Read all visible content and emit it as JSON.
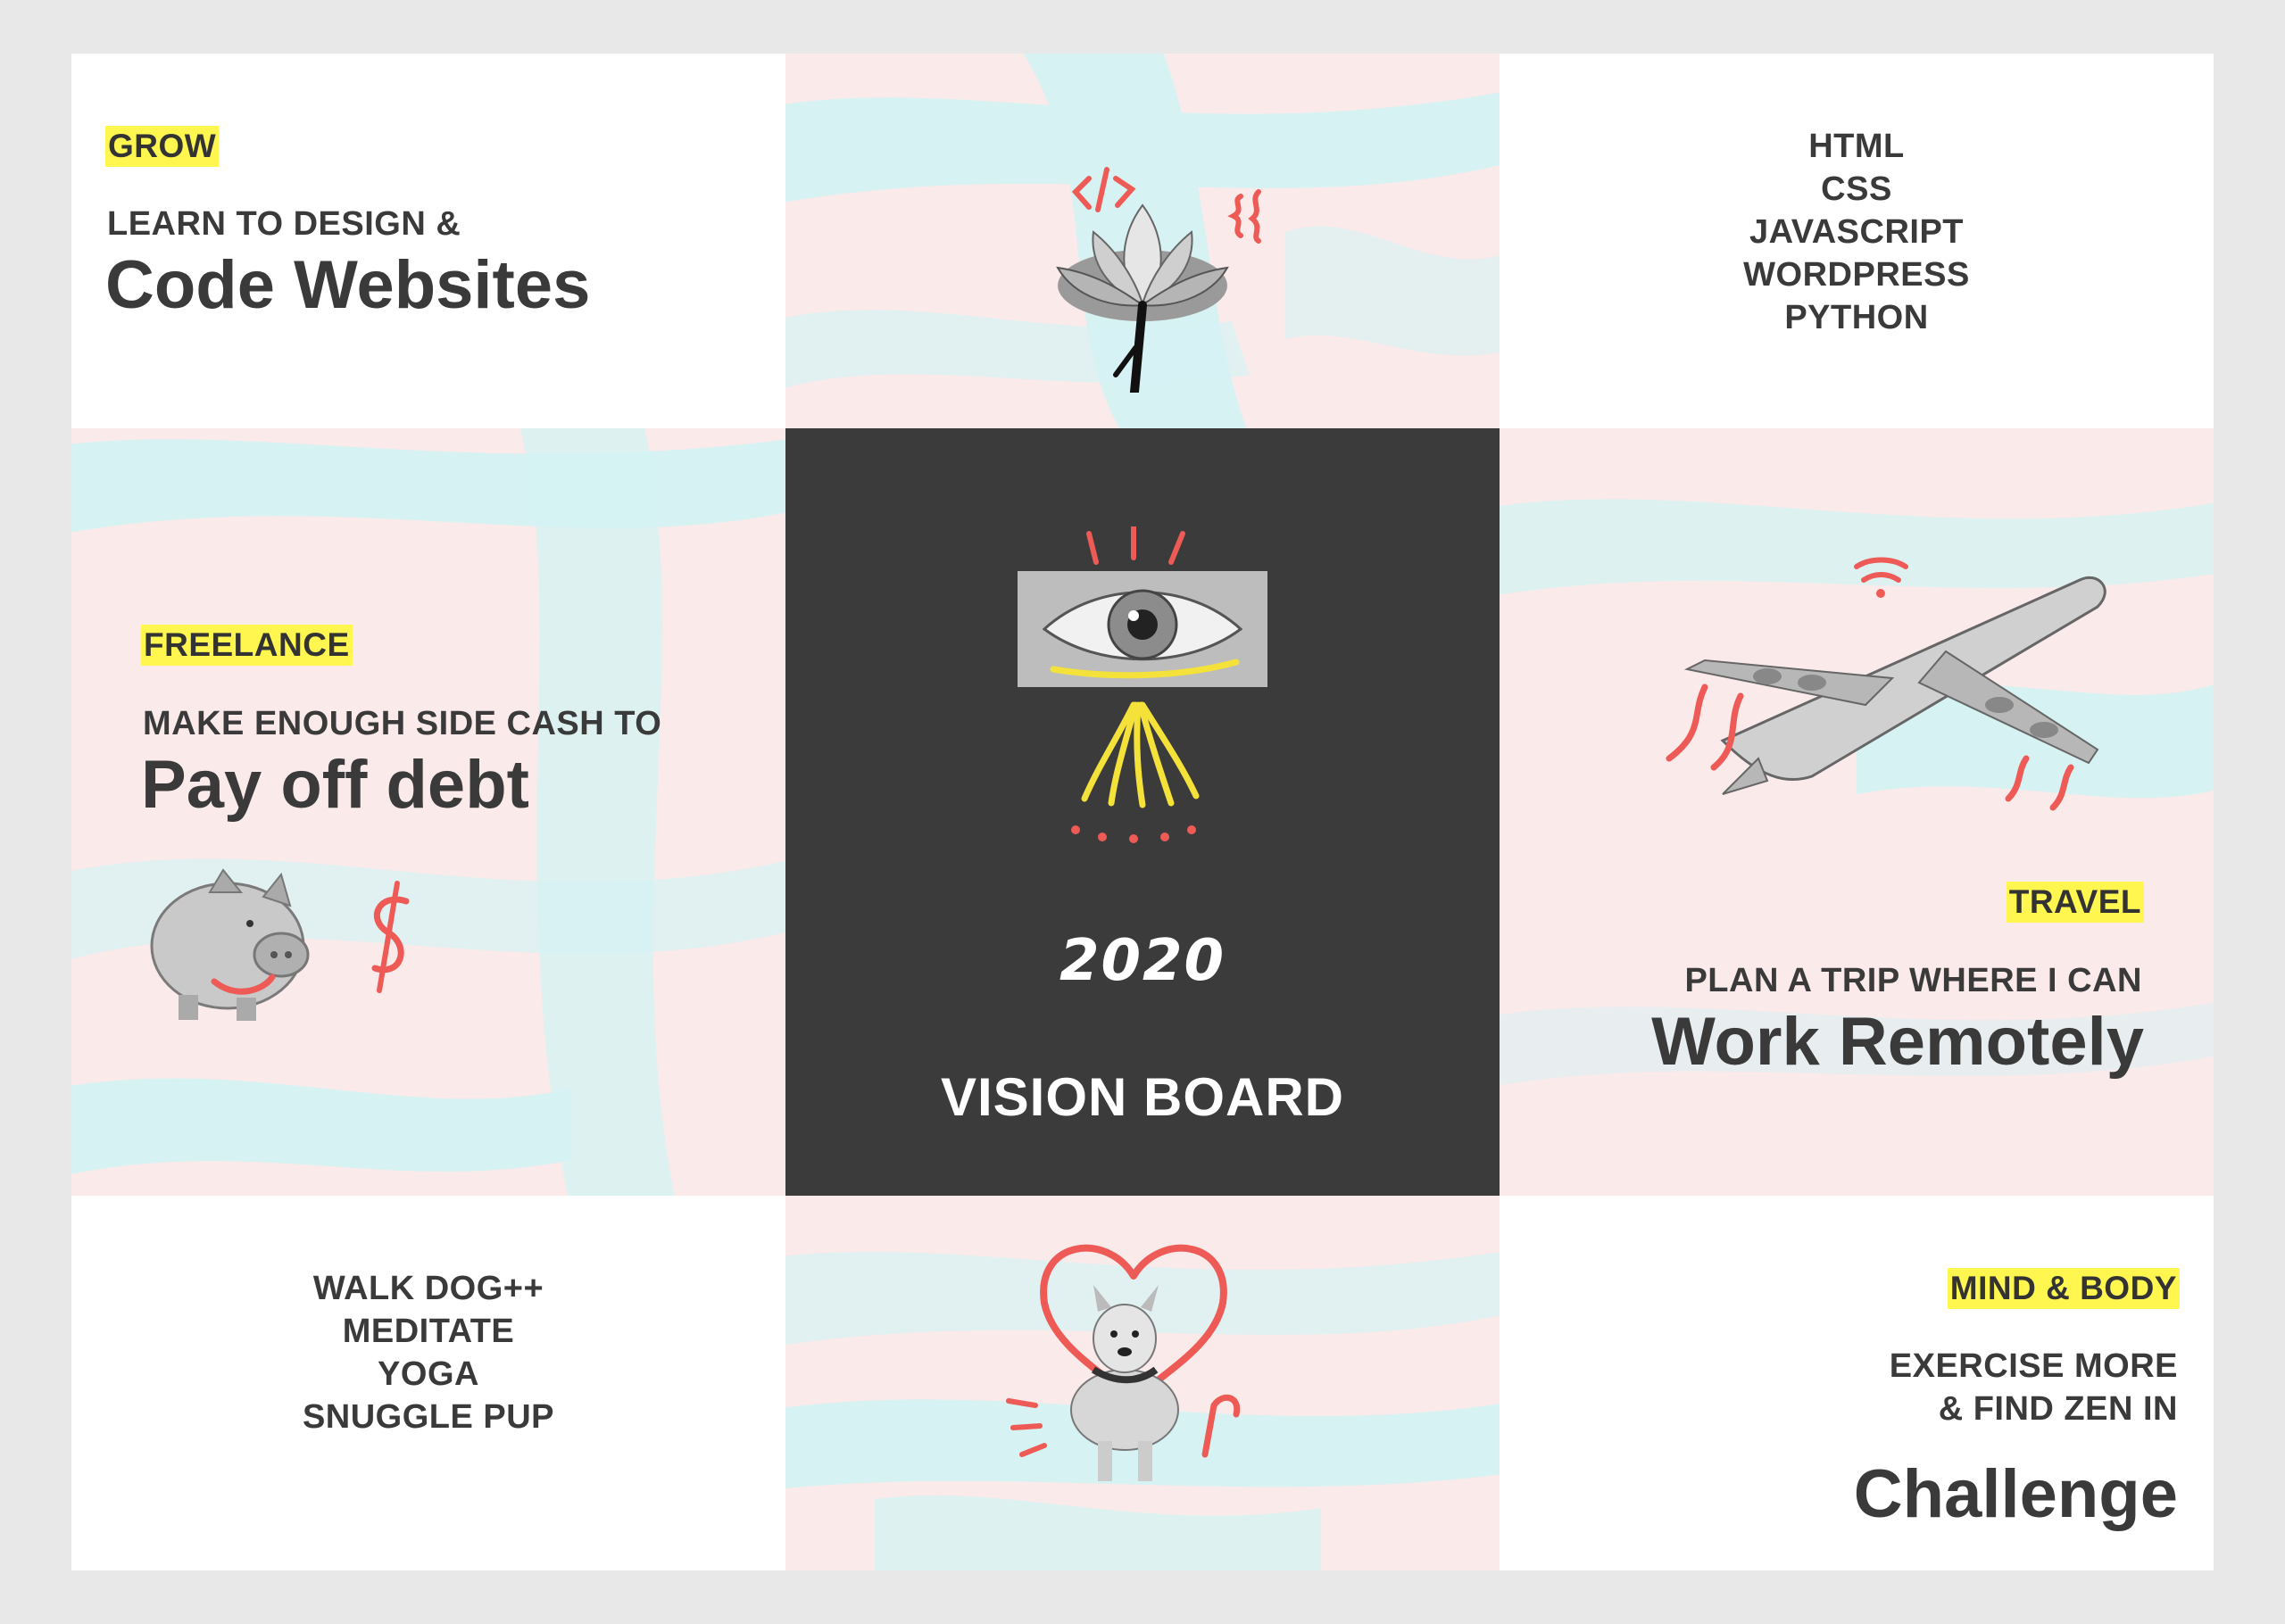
{
  "colors": {
    "background": "#e8e8e8",
    "highlight": "#fff64f",
    "text": "#3a3a3a",
    "pastel_pink": "#fbeaea",
    "pastel_blue": "#d6f2f3",
    "center_dark": "#3b3b3b",
    "doodle_red": "#ee5a55",
    "doodle_yellow": "#f4e23a"
  },
  "grow": {
    "tag": "GROW",
    "line1": "LEARN TO DESIGN &",
    "line2": "Code Websites",
    "icon": "lotus-code-icon"
  },
  "skills": [
    "HTML",
    "CSS",
    "JAVASCRIPT",
    "WORDPRESS",
    "PYTHON"
  ],
  "freelance": {
    "tag": "FREELANCE",
    "line1": "MAKE ENOUGH SIDE CASH TO",
    "line2": "Pay off debt",
    "icon": "piggy-bank-icon"
  },
  "center": {
    "year": "2020",
    "title": "VISION BOARD",
    "icon": "eye-icon"
  },
  "travel": {
    "tag": "TRAVEL",
    "line1": "PLAN A TRIP WHERE I CAN",
    "line2": "Work Remotely",
    "icon": "airplane-icon"
  },
  "habits": [
    "WALK DOG++",
    "MEDITATE",
    "YOGA",
    "SNUGGLE PUP"
  ],
  "dog": {
    "icon": "dog-heart-icon"
  },
  "mind_body": {
    "tag": "MIND & BODY",
    "line1": "EXERCISE MORE",
    "line2": "& FIND ZEN IN",
    "line3": "Challenge"
  }
}
